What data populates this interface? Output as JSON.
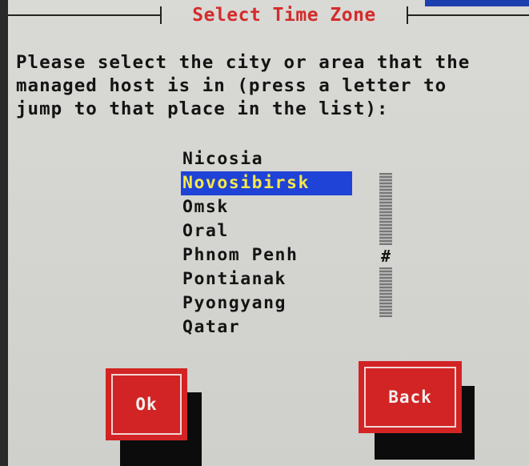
{
  "dialog": {
    "title": "Select Time Zone",
    "instructions": [
      "Please select the city or area that the",
      "managed host is in (press a letter to",
      "jump to that place in the list):"
    ]
  },
  "timezone_list": {
    "items": [
      {
        "label": "Nicosia",
        "selected": false
      },
      {
        "label": "Novosibirsk",
        "selected": true
      },
      {
        "label": "Omsk",
        "selected": false
      },
      {
        "label": "Oral",
        "selected": false
      },
      {
        "label": "Phnom Penh",
        "selected": false
      },
      {
        "label": "Pontianak",
        "selected": false
      },
      {
        "label": "Pyongyang",
        "selected": false
      },
      {
        "label": "Qatar",
        "selected": false
      }
    ],
    "scrollbar_thumb": "#"
  },
  "buttons": {
    "ok_label": "Ok",
    "back_label": "Back"
  },
  "colors": {
    "title": "#d22c2c",
    "selection_background": "#1f43d6",
    "selection_text": "#f6e84a",
    "button": "#d22424"
  }
}
